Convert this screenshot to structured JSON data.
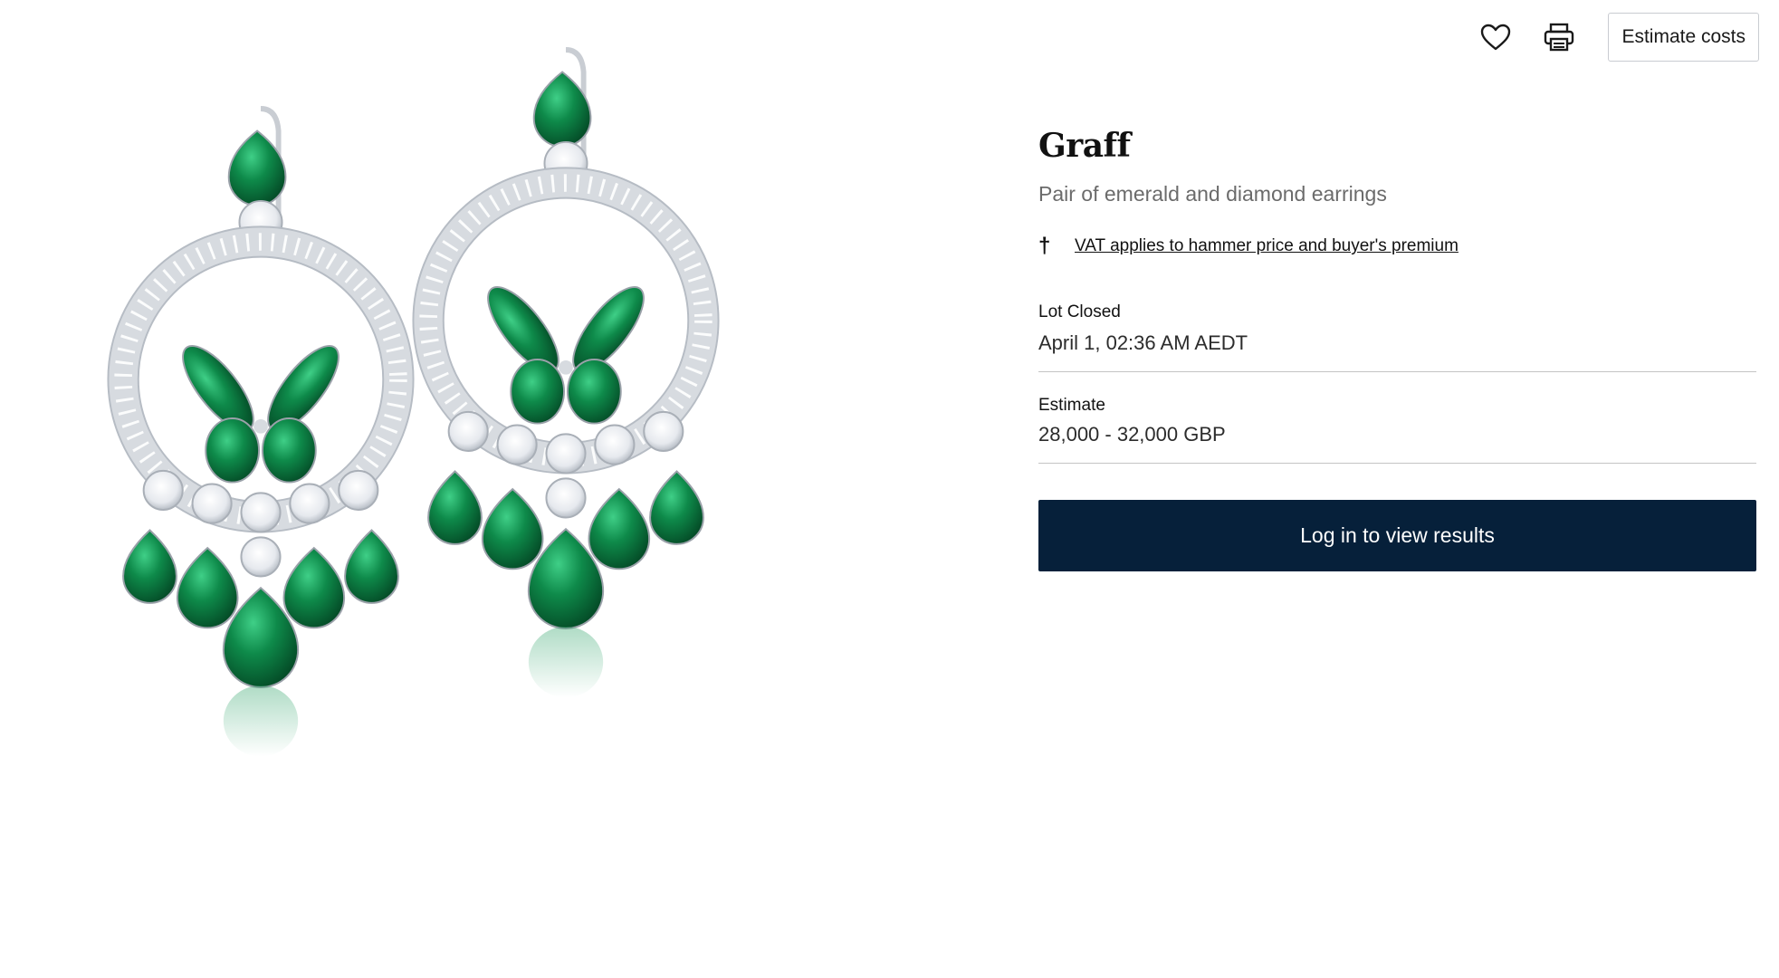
{
  "toolbar": {
    "favorite_icon": "heart-icon",
    "print_icon": "printer-icon",
    "estimate_costs_label": "Estimate costs"
  },
  "product_image": {
    "alt": "Graff Pair of emerald and diamond earrings"
  },
  "lot": {
    "brand": "Graff",
    "title": "Pair of emerald and diamond earrings",
    "vat_symbol": "†",
    "vat_notice": "VAT applies to hammer price and buyer's premium",
    "status_label": "Lot Closed",
    "closed_at": "April 1, 02:36 AM AEDT",
    "estimate_label": "Estimate",
    "estimate_value": "28,000 - 32,000 GBP",
    "login_label": "Log in to view results"
  },
  "colors": {
    "primary_button": "#06203a",
    "emerald": "#0e8a4a",
    "metal": "#cfd3d8"
  }
}
